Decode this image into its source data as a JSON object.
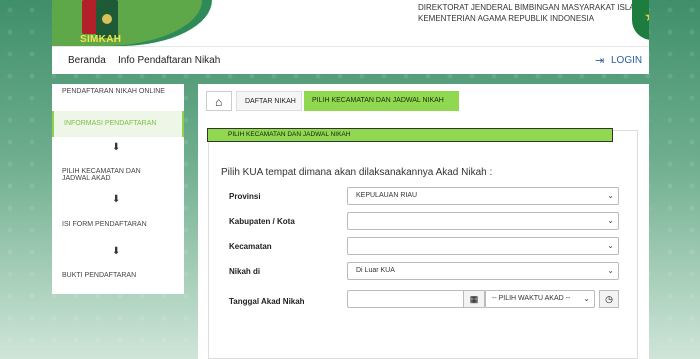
{
  "header": {
    "brand": "SIMKAH",
    "org_line1": "DIREKTORAT JENDERAL BIMBINGAN MASYARAKAT ISLAM",
    "org_line2": "KEMENTERIAN AGAMA REPUBLIK INDONESIA"
  },
  "nav": {
    "items": [
      "Beranda",
      "Info Pendaftaran Nikah"
    ],
    "login_label": "LOGIN"
  },
  "sidebar": {
    "items": [
      "PENDAFTARAN NIKAH ONLINE",
      "INFORMASI PENDAFTARAN",
      "PILIH KECAMATAN DAN JADWAL AKAD",
      "ISI FORM PENDAFTARAN",
      "BUKTI PENDAFTARAN"
    ]
  },
  "breadcrumb": {
    "items": [
      "DAFTAR NIKAH",
      "PILIH KECAMATAN DAN JADWAL NIKAH"
    ]
  },
  "card": {
    "title": "PILIH KECAMATAN DAN JADWAL NIKAH",
    "instruction": "Pilih KUA tempat dimana akan dilaksanakannya Akad Nikah :"
  },
  "form": {
    "provinsi_label": "Provinsi",
    "provinsi_value": "KEPULAUAN RIAU",
    "kabupaten_label": "Kabupaten / Kota",
    "kabupaten_value": "",
    "kecamatan_label": "Kecamatan",
    "kecamatan_value": "",
    "nikah_di_label": "Nikah di",
    "nikah_di_value": "Di Luar KUA",
    "tanggal_label": "Tanggal Akad Nikah",
    "tanggal_value": "",
    "waktu_value": "-- PILIH WAKTU AKAD --"
  },
  "colors": {
    "accent_green": "#8fd84f",
    "brand_dark": "#2e8b57",
    "link_blue": "#2a5d9f"
  }
}
